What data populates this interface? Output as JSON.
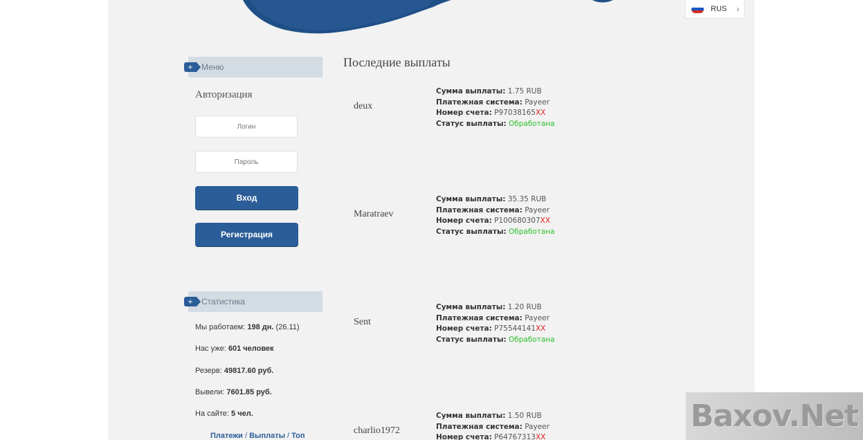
{
  "language": {
    "label": "RUS",
    "flag_colors": [
      "#ffffff",
      "#1c57c4",
      "#d52b1e"
    ]
  },
  "sidebar": {
    "menu_title": "Меню",
    "auth_title": "Авторизация",
    "login_placeholder": "Логин",
    "password_placeholder": "Пароль",
    "login_button": "Вход",
    "register_button": "Регистрация",
    "stats_title": "Статистика",
    "stats": {
      "working_label": "Мы работаем: ",
      "working_value": "198 дн.",
      "working_date": " (26.11)",
      "users_label": "Нас уже: ",
      "users_value": "601 человек",
      "reserve_label": "Резерв: ",
      "reserve_value": "49817.60 руб.",
      "withdrawn_label": "Вывели: ",
      "withdrawn_value": "7601.85 руб.",
      "online_label": "На сайте: ",
      "online_value": "5 чел."
    },
    "links": [
      "Платежи",
      "Выплаты",
      "Топ"
    ],
    "link_separator": " / "
  },
  "main": {
    "title": "Последние выплаты",
    "labels": {
      "amount": "Сумма выплаты:",
      "system": "Платежная система:",
      "account": "Номер счета:",
      "status": "Статус выплаты:"
    },
    "payouts": [
      {
        "user": "deux",
        "amount": "1.75 RUB",
        "system": "Payeer",
        "account": "P97038165",
        "masked": "XX",
        "status": "Обработана"
      },
      {
        "user": "Maratraev",
        "amount": "35.35 RUB",
        "system": "Payeer",
        "account": "P100680307",
        "masked": "XX",
        "status": "Обработана"
      },
      {
        "user": "Sent",
        "amount": "1.20 RUB",
        "system": "Payeer",
        "account": "P75544141",
        "masked": "XX",
        "status": "Обработана"
      },
      {
        "user": "charlio1972",
        "amount": "1.50 RUB",
        "system": "Payeer",
        "account": "P64767313",
        "masked": "XX",
        "status": ""
      }
    ]
  },
  "watermark": "Baxov.Net",
  "colors": {
    "brand_blue": "#2b5d98",
    "status_ok": "#2bbf2b",
    "mask_red": "#e02020",
    "side_header": "#d3dbe3"
  }
}
